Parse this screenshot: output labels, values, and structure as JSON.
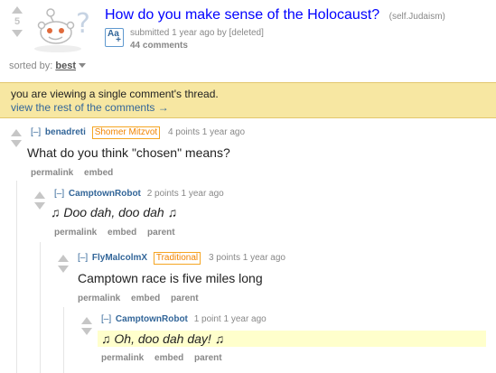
{
  "post": {
    "score": "5",
    "title": "How do you make sense of the Holocaust?",
    "domain": "(self.Judaism)",
    "aa_label": "Aa",
    "aa_plus": "+",
    "tagline": "submitted 1 year ago by [deleted]",
    "comments": "44 comments"
  },
  "sort": {
    "label": "sorted by:",
    "value": "best"
  },
  "notice": {
    "text": "you are viewing a single comment's thread.",
    "link": "view the rest of the comments →"
  },
  "comments": [
    {
      "toggle": "[–]",
      "author": "benadreti",
      "flair": "Shomer Mitzvot",
      "meta": "4 points 1 year ago",
      "body": "What do you think \"chosen\" means?",
      "actions": [
        "permalink",
        "embed"
      ]
    },
    {
      "toggle": "[–]",
      "author": "CamptownRobot",
      "meta": "2 points 1 year ago",
      "body": "♫ Doo dah, doo dah ♫",
      "actions": [
        "permalink",
        "embed",
        "parent"
      ]
    },
    {
      "toggle": "[–]",
      "author": "FlyMalcolmX",
      "flair": "Traditional",
      "meta": "3 points 1 year ago",
      "body": "Camptown race is five miles long",
      "actions": [
        "permalink",
        "embed",
        "parent"
      ]
    },
    {
      "toggle": "[–]",
      "author": "CamptownRobot",
      "meta": "1 point 1 year ago",
      "body": "♫ Oh, doo dah day! ♫",
      "actions": [
        "permalink",
        "embed",
        "parent"
      ]
    }
  ],
  "colors": {
    "link": "#336699",
    "title": "#0000ff",
    "notice_bg": "#f7e7a2",
    "flair": "#f28500"
  }
}
